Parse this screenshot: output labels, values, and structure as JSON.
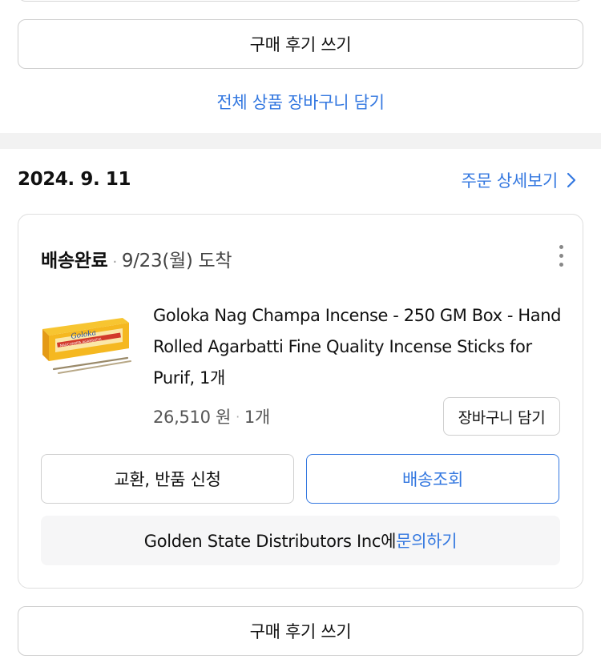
{
  "previous_order": {
    "review_button": "구매 후기 쓰기",
    "add_all_to_cart": "전체 상품 장바구니 담기"
  },
  "order": {
    "date": "2024. 9. 11",
    "detail_link": "주문 상세보기",
    "status": "배송완료",
    "status_separator": "·",
    "arrival": "9/23(월) 도착",
    "product": {
      "title": "Goloka Nag Champa Incense - 250 GM Box - Hand Rolled Agarbatti Fine Quality Incense Sticks for Purif, 1개",
      "price": "26,510 원",
      "separator": "·",
      "quantity": "1개",
      "image_brand_text": "Goloka",
      "image_product_text": "NAGCHAMPA AGARBATHI"
    },
    "add_to_cart": "장바구니 담기",
    "exchange_return": "교환, 반품 신청",
    "track_delivery": "배송조회",
    "seller": "Golden State Distributors Inc에",
    "inquiry_link": "문의하기",
    "review_button": "구매 후기 쓰기"
  },
  "colors": {
    "accent": "#3478e0",
    "divider_band": "#f2f2f2",
    "seller_box_bg": "#f6f6f7"
  }
}
